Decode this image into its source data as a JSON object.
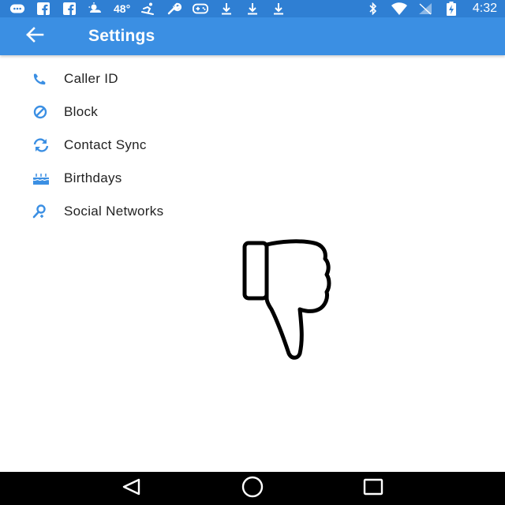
{
  "status_bar": {
    "temperature": "48°",
    "time": "4:32",
    "icons_left": [
      "messages-icon",
      "facebook-icon",
      "facebook-icon",
      "weather-icon",
      "skiing-icon",
      "wrench-icon",
      "gamepad-icon",
      "download-icon",
      "download-icon",
      "download-icon"
    ],
    "icons_right": [
      "bluetooth-icon",
      "wifi-icon",
      "signal-icon",
      "battery-charging-icon"
    ]
  },
  "app_bar": {
    "title": "Settings",
    "back_icon": "arrow-back-icon"
  },
  "settings": {
    "items": [
      {
        "label": "Caller ID",
        "icon": "phone-icon"
      },
      {
        "label": "Block",
        "icon": "block-icon"
      },
      {
        "label": "Contact Sync",
        "icon": "sync-icon"
      },
      {
        "label": "Birthdays",
        "icon": "cake-icon"
      },
      {
        "label": "Social Networks",
        "icon": "person-search-icon"
      }
    ]
  },
  "nav_bar": {
    "buttons": [
      "back-triangle-icon",
      "home-circle-icon",
      "recents-square-icon"
    ]
  },
  "colors": {
    "status_bar": "#2f7fd3",
    "app_bar": "#3b8fe3",
    "accent_icon": "#3b8fe3",
    "text": "#222222",
    "nav_bar": "#000000"
  }
}
